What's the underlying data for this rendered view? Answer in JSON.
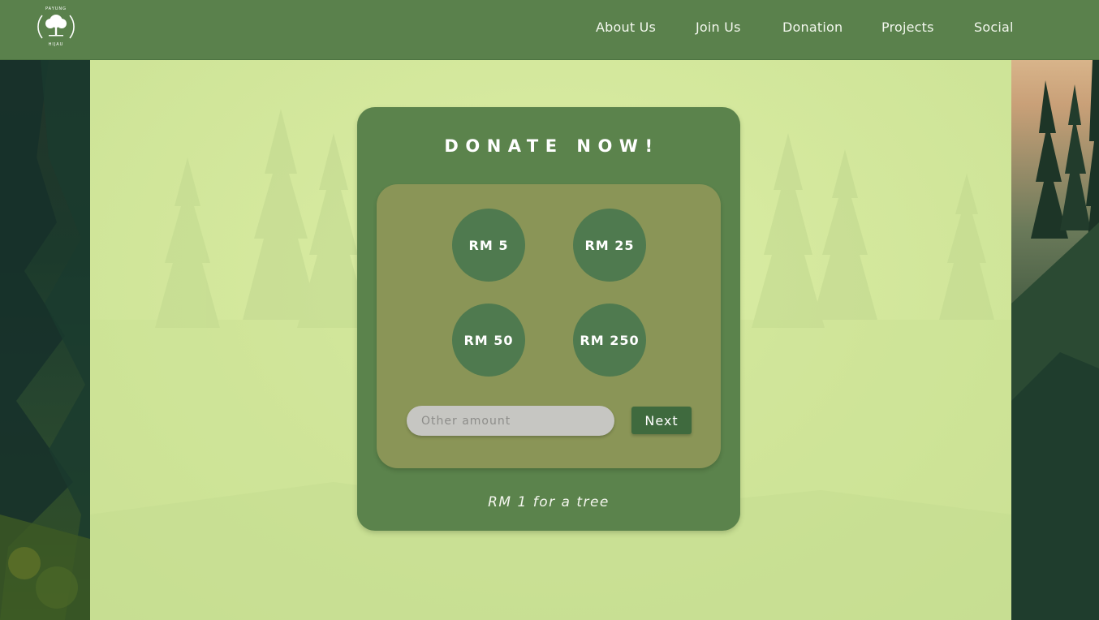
{
  "header": {
    "logo_text": "PAYUNG HIJAU",
    "nav": [
      {
        "label": "About Us"
      },
      {
        "label": "Join Us"
      },
      {
        "label": "Donation"
      },
      {
        "label": "Projects"
      },
      {
        "label": "Social"
      }
    ]
  },
  "donate": {
    "title": "DONATE NOW!",
    "amounts": [
      {
        "label": "RM 5"
      },
      {
        "label": "RM 25"
      },
      {
        "label": "RM 50"
      },
      {
        "label": "RM 250"
      }
    ],
    "other_amount": {
      "value": "",
      "placeholder": "Other amount"
    },
    "next_label": "Next",
    "tagline": "RM 1 for a tree"
  },
  "colors": {
    "header_bg": "#5a814c",
    "card_bg": "#5b834c",
    "inner_bg": "#8a9557",
    "circle_bg": "#4f7a4f",
    "button_bg": "#3f6a3e",
    "page_bg": "#d4e89d"
  },
  "icons": {
    "logo": "tree-logo-icon"
  }
}
